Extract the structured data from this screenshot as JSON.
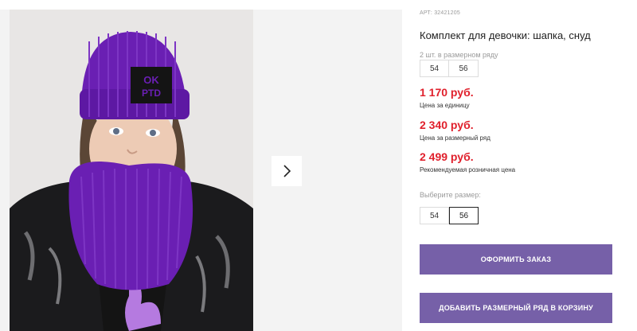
{
  "product": {
    "sku": "АРТ: 32421205",
    "title": "Комплект для девочки: шапка, снуд",
    "pack_note": "2 шт. в размерном ряду",
    "pack_sizes": [
      "54",
      "56"
    ],
    "hat_logo_line1": "OK",
    "hat_logo_line2": "PTD"
  },
  "prices": {
    "unit_price": "1 170 руб.",
    "unit_caption": "Цена за единицу",
    "row_price": "2 340 руб.",
    "row_caption": "Цена за размерный ряд",
    "retail_price": "2 499 руб.",
    "retail_caption": "Рекомендуемая розничная цена"
  },
  "size_picker": {
    "label": "Выберите размер:",
    "options": [
      "54",
      "56"
    ],
    "selected": "56"
  },
  "buttons": {
    "order": "ОФОРМИТЬ ЗАКАЗ",
    "add_row": "ДОБАВИТЬ РАЗМЕРНЫЙ РЯД В КОРЗИНУ"
  },
  "colors": {
    "accent": "#7660a8",
    "price": "#e0202c",
    "knit_purple": "#6a1fb3"
  },
  "icons": {
    "gallery_next": "chevron-right-icon"
  }
}
